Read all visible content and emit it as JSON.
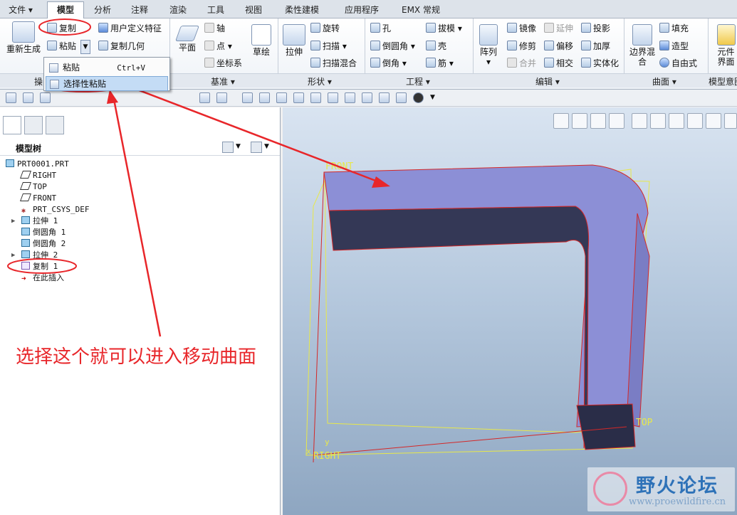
{
  "menu_tabs": [
    "文件",
    "模型",
    "分析",
    "注释",
    "渲染",
    "工具",
    "视图",
    "柔性建模",
    "应用程序",
    "EMX 常规"
  ],
  "ribbon": {
    "regen": "重新生成",
    "copy": "复制",
    "paste": "粘贴",
    "user_feature": "用户定义特征",
    "copy_geom": "复制几何",
    "plane": "平面",
    "axis": "轴",
    "point": "点",
    "csys": "坐标系",
    "sketch": "草绘",
    "extrude": "拉伸",
    "revolve": "旋转",
    "sweep": "扫描",
    "swept_blend": "扫描混合",
    "hole": "孔",
    "draft": "拔模",
    "round": "倒圆角",
    "shell": "壳",
    "chamfer": "倒角",
    "rib": "筋",
    "pattern": "阵列",
    "mirror": "镜像",
    "extend": "延伸",
    "project": "投影",
    "trim": "修剪",
    "offset": "偏移",
    "thicken": "加厚",
    "merge": "合并",
    "intersect": "相交",
    "solidify": "实体化",
    "boundary_blend": "边界混合",
    "fill": "填充",
    "style": "造型",
    "freestyle": "自由式",
    "component_iface": "元件界面"
  },
  "groups": {
    "ops": "操",
    "datum": "基准",
    "shape": "形状",
    "eng": "工程",
    "edit": "编辑",
    "surfaces": "曲面",
    "model_intent": "模型意图"
  },
  "paste_menu": {
    "paste": "粘贴",
    "paste_shortcut": "Ctrl+V",
    "paste_special": "选择性粘贴"
  },
  "tree": {
    "header": "模型树",
    "nodes": [
      "PRT0001.PRT",
      "RIGHT",
      "TOP",
      "FRONT",
      "PRT_CSYS_DEF",
      "拉伸 1",
      "倒圆角 1",
      "倒圆角 2",
      "拉伸 2",
      "复制 1",
      "在此插入"
    ]
  },
  "viewport_labels": {
    "front": "FRONT",
    "top": "TOP",
    "right": "RIGHT",
    "axis_x": "x",
    "axis_y": "y"
  },
  "annotation": "选择这个就可以进入移动曲面",
  "watermark": {
    "name": "野火论坛",
    "url": "www.proewildfire.cn"
  }
}
